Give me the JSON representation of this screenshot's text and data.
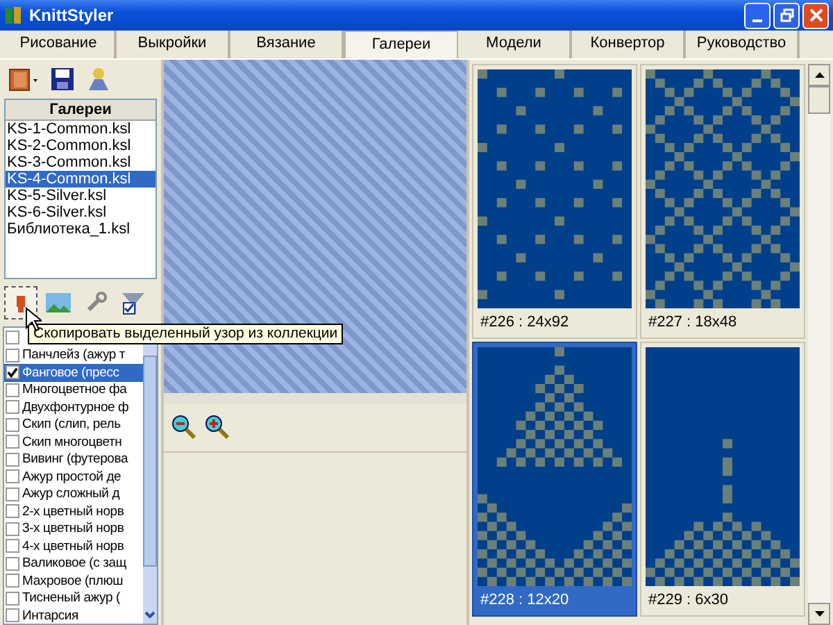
{
  "window": {
    "title": "KnittStyler"
  },
  "tabs": [
    {
      "label": "Рисование",
      "selected": false
    },
    {
      "label": "Выкройки",
      "selected": false
    },
    {
      "label": "Вязание",
      "selected": false
    },
    {
      "label": "Галереи",
      "selected": true
    },
    {
      "label": "Модели",
      "selected": false
    },
    {
      "label": "Конвертор",
      "selected": false
    },
    {
      "label": "Руководство",
      "selected": false
    }
  ],
  "gallery": {
    "header": "Галереи",
    "files": [
      {
        "name": "KS-1-Common.ksl",
        "selected": false
      },
      {
        "name": "KS-2-Common.ksl",
        "selected": false
      },
      {
        "name": "KS-3-Common.ksl",
        "selected": false
      },
      {
        "name": "KS-4-Common.ksl",
        "selected": true
      },
      {
        "name": "KS-5-Silver.ksl",
        "selected": false
      },
      {
        "name": "KS-6-Silver.ksl",
        "selected": false
      },
      {
        "name": "Библиотека_1.ksl",
        "selected": false
      }
    ]
  },
  "tooltip": "Скопировать выделенный узор из коллекции",
  "patterns": [
    {
      "checked": false,
      "selected": false
    },
    {
      "label": "Панчлейз (ажур т",
      "checked": false,
      "selected": false
    },
    {
      "label": "Фанговое (пресс",
      "checked": true,
      "selected": true
    },
    {
      "label": "Многоцветное фа",
      "checked": false,
      "selected": false
    },
    {
      "label": "Двухфонтурное ф",
      "checked": false,
      "selected": false
    },
    {
      "label": "Скип (слип, рель",
      "checked": false,
      "selected": false
    },
    {
      "label": "Скип многоцветн",
      "checked": false,
      "selected": false
    },
    {
      "label": "Вивинг (футерова",
      "checked": false,
      "selected": false
    },
    {
      "label": "Ажур простой де",
      "checked": false,
      "selected": false
    },
    {
      "label": "Ажур сложный д",
      "checked": false,
      "selected": false
    },
    {
      "label": "2-х цветный норв",
      "checked": false,
      "selected": false
    },
    {
      "label": "3-х цветный норв",
      "checked": false,
      "selected": false
    },
    {
      "label": "4-х цветный норв",
      "checked": false,
      "selected": false
    },
    {
      "label": "Валиковое (с защ",
      "checked": false,
      "selected": false
    },
    {
      "label": "Махровое (плюш",
      "checked": false,
      "selected": false
    },
    {
      "label": "Тисненый ажур (",
      "checked": false,
      "selected": false
    },
    {
      "label": "Интарсия",
      "checked": false,
      "selected": false
    }
  ],
  "thumbnails": [
    {
      "caption": "#226 : 24x92",
      "selected": false
    },
    {
      "caption": "#227 : 18x48",
      "selected": false
    },
    {
      "caption": "#228 : 12x20",
      "selected": true
    },
    {
      "caption": "#229 : 6x30",
      "selected": false
    }
  ]
}
